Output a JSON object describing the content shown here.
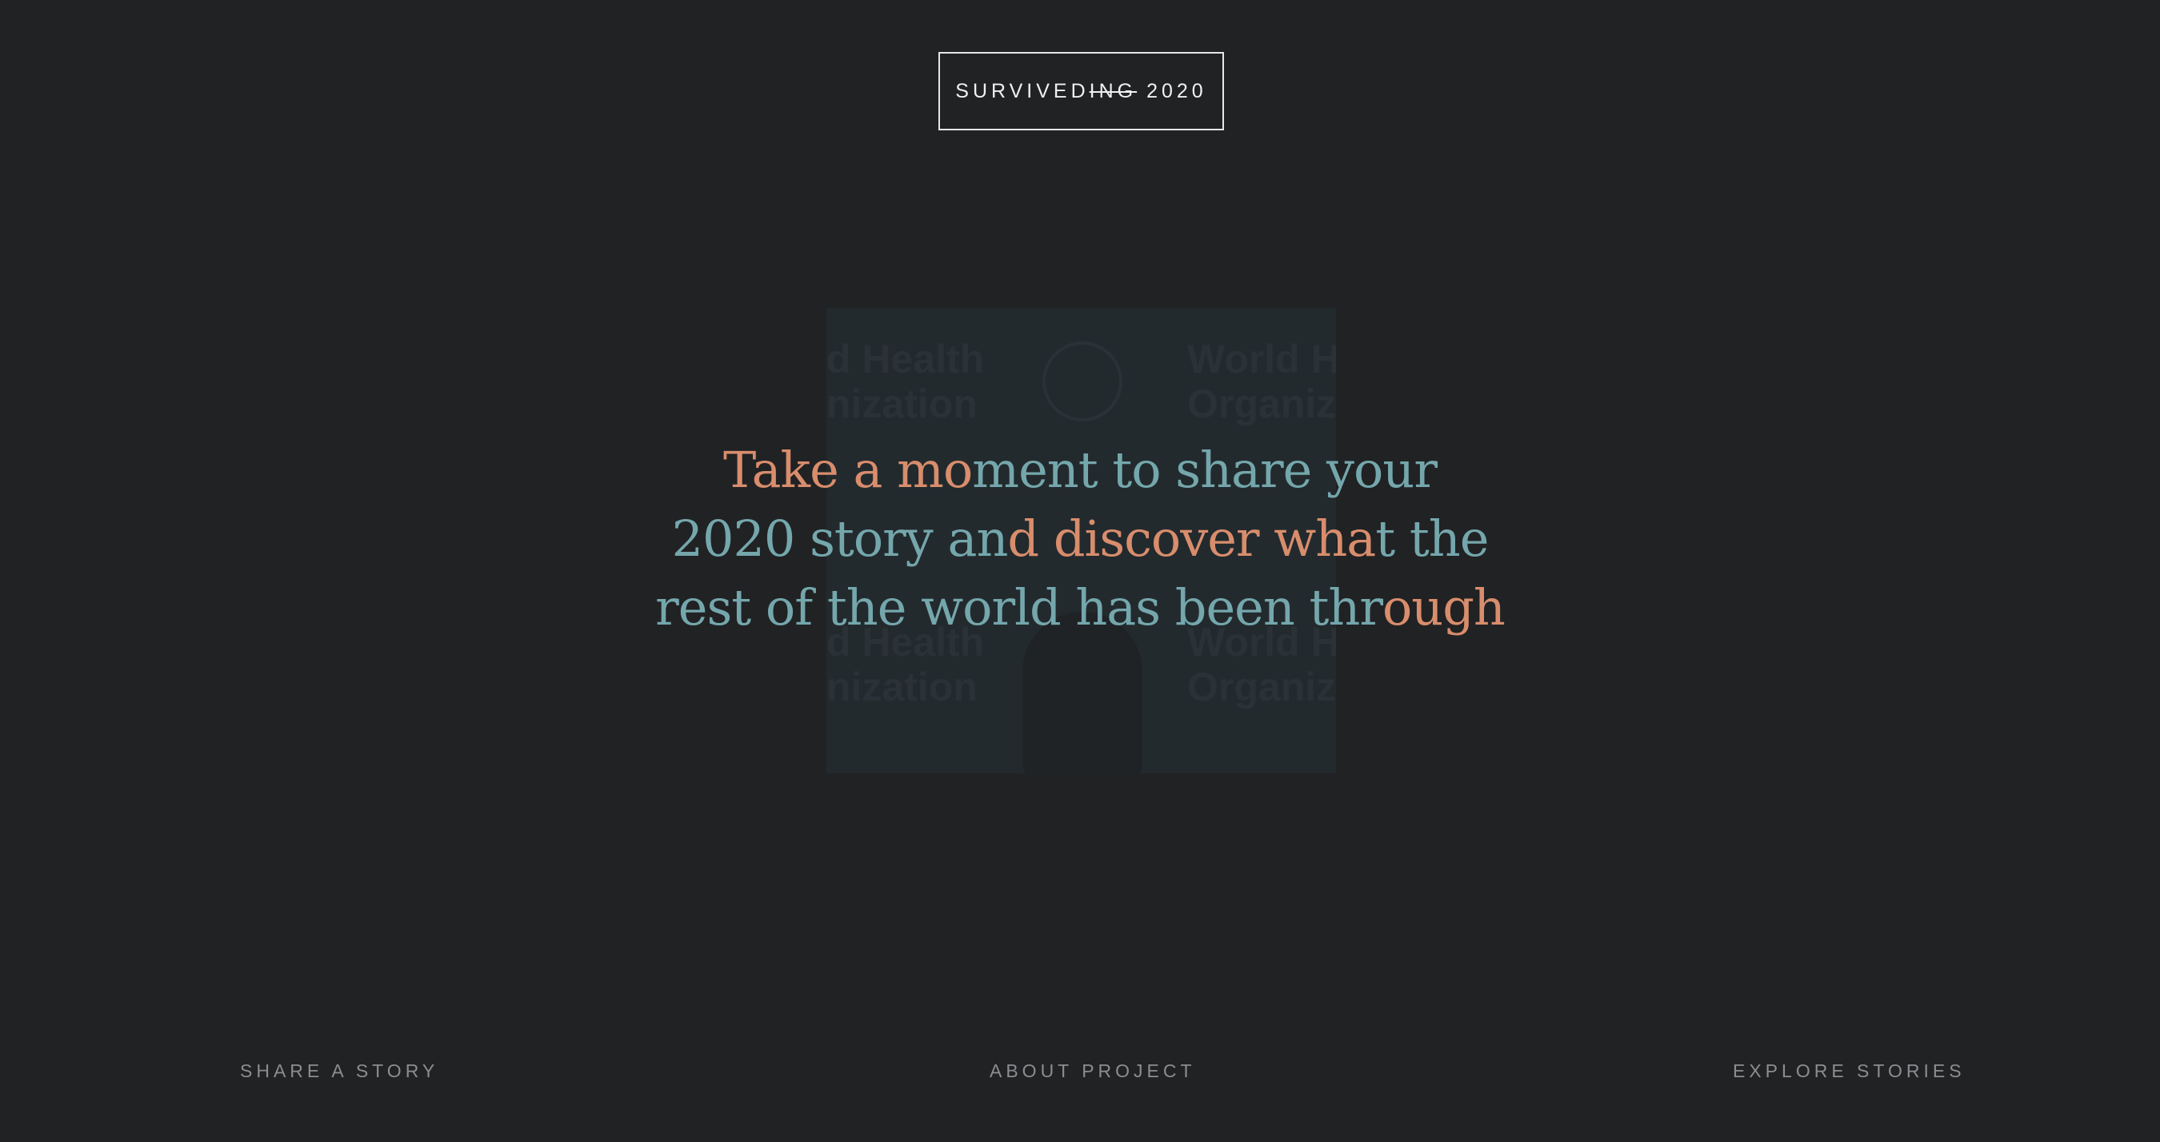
{
  "logo": {
    "main": "SURVIVED",
    "struck": "ING",
    "year": "2020"
  },
  "background_image": {
    "text_line_1": "d Health",
    "text_line_2": "nization",
    "text_right_1": "World H",
    "text_right_2": "Organiz"
  },
  "headline": {
    "segments": [
      {
        "text": "Take a mo",
        "color": "orange"
      },
      {
        "text": "ment to share your",
        "color": "teal"
      },
      {
        "text": "2020 story an",
        "color": "teal"
      },
      {
        "text": "d discover wha",
        "color": "orange"
      },
      {
        "text": "t the",
        "color": "teal"
      },
      {
        "text": "rest of the world has been thr",
        "color": "teal"
      },
      {
        "text": "ough",
        "color": "orange"
      }
    ]
  },
  "nav": {
    "share": "SHARE A STORY",
    "about": "ABOUT PROJECT",
    "explore": "EXPLORE STORIES"
  },
  "colors": {
    "background": "#212224",
    "orange": "#d88d6c",
    "teal": "#74a7ac",
    "nav_text": "#8b8d90",
    "logo": "#f0f0f0"
  }
}
